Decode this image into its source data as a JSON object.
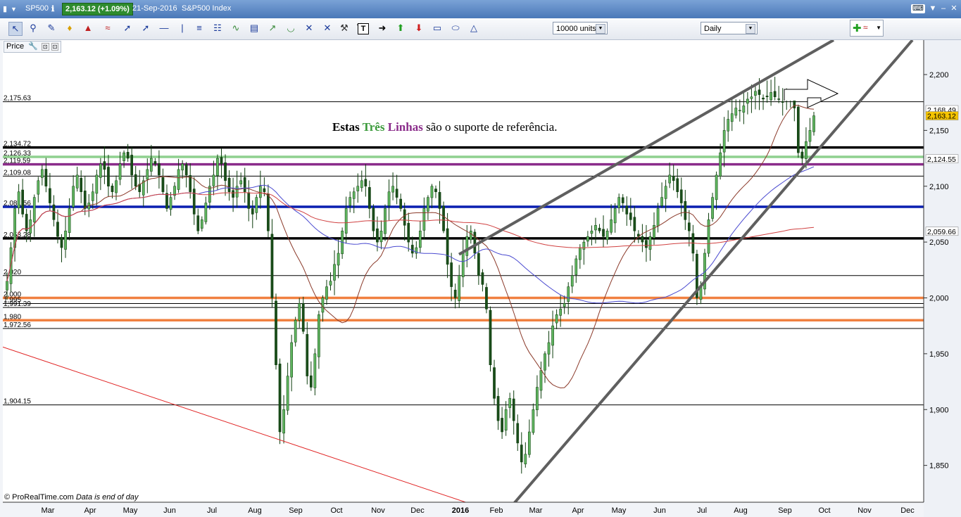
{
  "window": {
    "symbol": "SP500",
    "price_badge": "2,163.12 (+1.09%)",
    "date_label": "21-Sep-2016",
    "instrument": "S&P500 Index"
  },
  "toolbar": {
    "units_value": "10000 units",
    "timeframe_value": "Daily",
    "tools": [
      "pointer",
      "zoom",
      "ruler",
      "alert",
      "fan",
      "channel",
      "line",
      "segment",
      "horizontal-line",
      "vertical-line",
      "fibonacci",
      "gann",
      "regression",
      "text-annotation",
      "trend-tools",
      "arc",
      "cross-line",
      "cross-line-2",
      "hammer-delete",
      "trash",
      "text",
      "arrow-right",
      "arrow-up-green",
      "arrow-down-red",
      "rectangle",
      "ellipse",
      "triangle"
    ]
  },
  "price_tab": {
    "label": "Price"
  },
  "annotation": {
    "part1": "Estas ",
    "part2": "Três",
    "part3": " ",
    "part4": "Linhas",
    "part5": " são o suporte de referência.",
    "color_part2": "#3a9a3a",
    "color_part4": "#8a2b8a"
  },
  "footer": {
    "copyright": "© ProRealTime.com",
    "note": "Data is end of day"
  },
  "chart_data": {
    "type": "candlestick",
    "title": "",
    "y_axis_ticks": [
      2200,
      2150,
      2100,
      2050,
      2000,
      1950,
      1900,
      1850
    ],
    "y_axis_tick_labels": [
      "2,200",
      "2,150",
      "2,100",
      "2,050",
      "2,000",
      "1,950",
      "1,900",
      "1,850"
    ],
    "ylim": [
      1810,
      2222
    ],
    "x_axis_labels": [
      "Mar",
      "Apr",
      "May",
      "Jun",
      "Jul",
      "Aug",
      "Sep",
      "Oct",
      "Nov",
      "Dec",
      "2016",
      "Feb",
      "Mar",
      "Apr",
      "May",
      "Jun",
      "Jul",
      "Aug",
      "Sep",
      "Oct",
      "Nov",
      "Dec"
    ],
    "grid": false,
    "last_price": 2163.12,
    "axis_price_tags": [
      {
        "value": 2168.49,
        "label": "2,168.49",
        "color": "#ffffff"
      },
      {
        "value": 2163.12,
        "label": "2,163.12",
        "color": "#f5c400"
      },
      {
        "value": 2124.55,
        "label": "2,124.55",
        "color": "#ffffff"
      },
      {
        "value": 2059.66,
        "label": "2,059.66",
        "color": "#ffffff"
      }
    ],
    "horizontal_levels": [
      {
        "value": 2175.63,
        "label": "2,175.63",
        "color": "#000000",
        "weight": "thin"
      },
      {
        "value": 2134.72,
        "label": "2,134.72",
        "color": "#000000",
        "weight": "thick"
      },
      {
        "value": 2126.33,
        "label": "2,126.33",
        "color": "#8fd18f",
        "weight": "thick"
      },
      {
        "value": 2119.59,
        "label": "2,119.59",
        "color": "#8a2b8a",
        "weight": "thick"
      },
      {
        "value": 2109.08,
        "label": "2,109.08",
        "color": "#000000",
        "weight": "thin"
      },
      {
        "value": 2081.56,
        "label": "2,081.56",
        "color": "#0a1fb0",
        "weight": "thick"
      },
      {
        "value": 2053.28,
        "label": "2,053.28",
        "color": "#000000",
        "weight": "thick"
      },
      {
        "value": 2020,
        "label": "2,020",
        "color": "#000000",
        "weight": "thin"
      },
      {
        "value": 2000,
        "label": "2,000",
        "color": "#f08040",
        "weight": "thick"
      },
      {
        "value": 1995,
        "label": "1,995",
        "color": "#000000",
        "weight": "thin"
      },
      {
        "value": 1991.39,
        "label": "1,991.39",
        "color": "#000000",
        "weight": "thin"
      },
      {
        "value": 1980,
        "label": "1,980",
        "color": "#f08040",
        "weight": "thick"
      },
      {
        "value": 1972.56,
        "label": "1,972.56",
        "color": "#000000",
        "weight": "thin"
      },
      {
        "value": 1904.15,
        "label": "1,904.15",
        "color": "#000000",
        "weight": "thin"
      }
    ],
    "series_closes": [
      2015,
      2045,
      2080,
      2095,
      2075,
      2060,
      2070,
      2090,
      2105,
      2115,
      2100,
      2085,
      2070,
      2055,
      2045,
      2060,
      2080,
      2100,
      2110,
      2095,
      2080,
      2085,
      2095,
      2110,
      2120,
      2115,
      2100,
      2095,
      2105,
      2120,
      2130,
      2125,
      2110,
      2100,
      2095,
      2105,
      2115,
      2125,
      2120,
      2110,
      2095,
      2080,
      2090,
      2100,
      2115,
      2120,
      2110,
      2095,
      2075,
      2060,
      2070,
      2085,
      2100,
      2110,
      2125,
      2120,
      2105,
      2095,
      2090,
      2100,
      2105,
      2095,
      2080,
      2075,
      2090,
      2100,
      2095,
      2060,
      2000,
      1940,
      1880,
      1900,
      1930,
      1960,
      1980,
      1995,
      1970,
      1930,
      1920,
      1950,
      1985,
      2000,
      2010,
      2015,
      2030,
      2040,
      2060,
      2080,
      2090,
      2095,
      2100,
      2105,
      2100,
      2080,
      2060,
      2050,
      2060,
      2080,
      2095,
      2100,
      2090,
      2080,
      2065,
      2050,
      2040,
      2045,
      2060,
      2080,
      2090,
      2100,
      2095,
      2080,
      2060,
      2030,
      2010,
      2000,
      2020,
      2040,
      2055,
      2060,
      2040,
      2020,
      2012,
      1990,
      1940,
      1910,
      1890,
      1880,
      1900,
      1910,
      1890,
      1870,
      1853,
      1860,
      1880,
      1900,
      1920,
      1935,
      1950,
      1960,
      1975,
      1985,
      1990,
      1995,
      2010,
      2020,
      2035,
      2045,
      2050,
      2055,
      2060,
      2065,
      2060,
      2055,
      2060,
      2070,
      2080,
      2090,
      2085,
      2075,
      2070,
      2060,
      2055,
      2050,
      2045,
      2055,
      2065,
      2080,
      2090,
      2100,
      2110,
      2105,
      2095,
      2085,
      2070,
      2060,
      2040,
      2000,
      2010,
      2040,
      2070,
      2090,
      2110,
      2130,
      2150,
      2160,
      2165,
      2170,
      2168,
      2172,
      2178,
      2180,
      2185,
      2182,
      2178,
      2180,
      2184,
      2180,
      2178,
      2175,
      2180,
      2182,
      2170,
      2130,
      2125,
      2140,
      2150,
      2163.12
    ],
    "moving_averages": [
      {
        "color": "#8b3a2a",
        "period_label": ""
      },
      {
        "color": "#4a4ad0",
        "period_label": ""
      },
      {
        "color": "#d04040",
        "period_label": ""
      }
    ],
    "trendlines": [
      {
        "color": "#5f5f5f",
        "description": "upper channel"
      },
      {
        "color": "#5f5f5f",
        "description": "lower support"
      },
      {
        "color": "#e02020",
        "description": "long-term down line"
      }
    ]
  }
}
